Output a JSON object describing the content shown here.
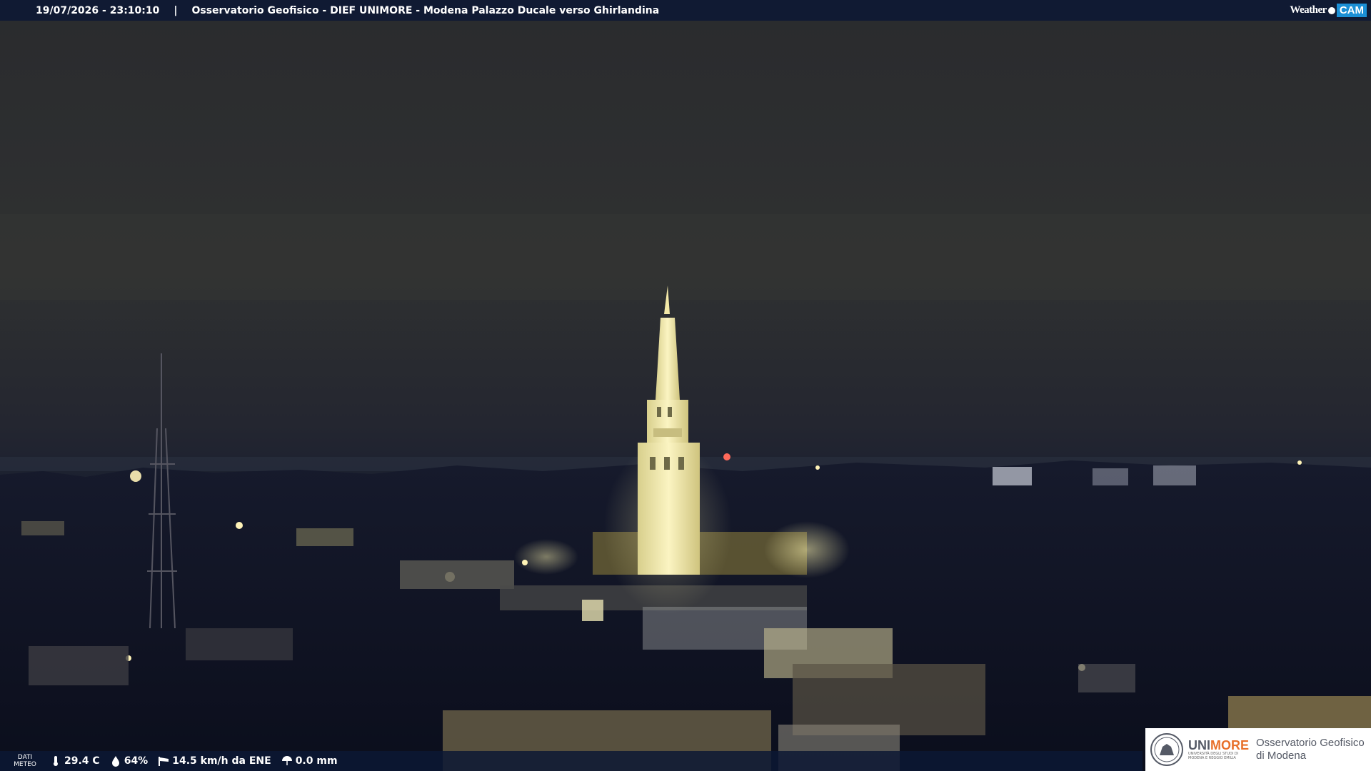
{
  "top_bar": {
    "timestamp": "19/07/2026 - 23:10:10",
    "separator": "|",
    "location": "Osservatorio Geofisico - DIEF UNIMORE - Modena Palazzo Ducale verso Ghirlandina"
  },
  "brand": {
    "weather": "Weather",
    "cam": "CAM"
  },
  "weather": {
    "label_line1": "DATI",
    "label_line2": "METEO",
    "temperature": "29.4 C",
    "humidity": "64%",
    "wind": "14.5 km/h da ENE",
    "rain": "0.0 mm"
  },
  "logo": {
    "uni_part1": "UNI",
    "uni_part2": "MORE",
    "uni_subtitle": "UNIVERSITÀ DEGLI STUDI DI MODENA E REGGIO EMILIA",
    "observatory_line1": "Osservatorio Geofisico",
    "observatory_line2": "di Modena"
  },
  "icons": [
    "thermometer-icon",
    "humidity-drop-icon",
    "wind-sock-icon",
    "rain-umbrella-icon",
    "university-seal-icon"
  ],
  "colors": {
    "bar_bg": "#0c1834",
    "accent_orange": "#e8702a",
    "cam_blue": "#1b8fd6",
    "sky": "#2b2d33",
    "tower_light": "#f5ecb0"
  }
}
